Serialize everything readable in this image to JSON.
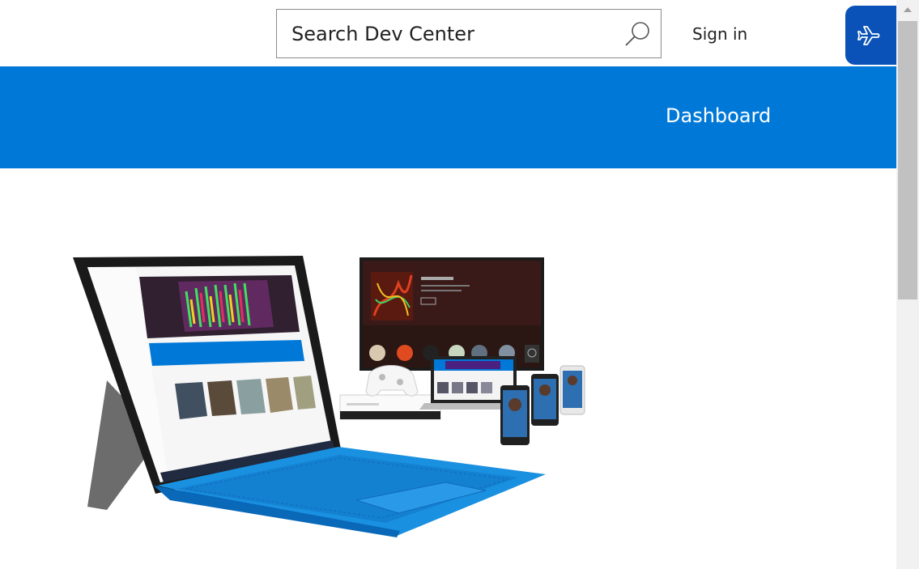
{
  "header": {
    "search": {
      "placeholder": "Search Dev Center",
      "value": ""
    },
    "sign_in_label": "Sign in",
    "feedback_icon": "airplane-icon"
  },
  "nav": {
    "dashboard_label": "Dashboard"
  },
  "hero": {
    "image": "devices-illustration",
    "devices": [
      "surface-tablet-with-keyboard",
      "tv-screen",
      "xbox-console",
      "xbox-controller",
      "laptop",
      "phones"
    ]
  },
  "colors": {
    "brand_blue": "#0078d7",
    "feedback_blue": "#0a52b7",
    "keyboard_blue": "#1a90e0"
  }
}
